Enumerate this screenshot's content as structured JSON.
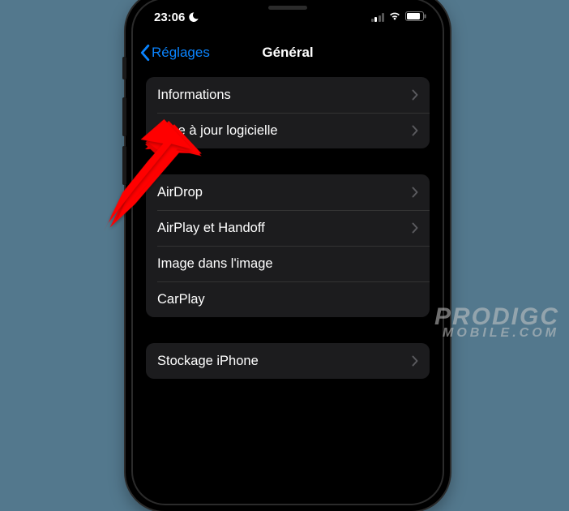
{
  "status": {
    "time": "23:06"
  },
  "nav": {
    "back": "Réglages",
    "title": "Général"
  },
  "groups": [
    {
      "rows": [
        {
          "label": "Informations",
          "chev": true
        },
        {
          "label": "Mise à jour logicielle",
          "chev": true
        }
      ]
    },
    {
      "rows": [
        {
          "label": "AirDrop",
          "chev": true
        },
        {
          "label": "AirPlay et Handoff",
          "chev": true
        },
        {
          "label": "Image dans l'image",
          "chev": false
        },
        {
          "label": "CarPlay",
          "chev": false
        }
      ]
    },
    {
      "rows": [
        {
          "label": "Stockage iPhone",
          "chev": true
        }
      ]
    }
  ],
  "watermark": {
    "line1": "PRODIGC",
    "line2": "MOBILE.COM"
  }
}
